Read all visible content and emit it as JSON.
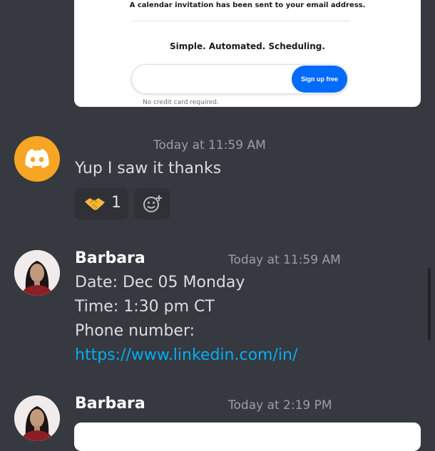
{
  "embed_card": {
    "invite_text": "A calendar invitation has been sent to your email address.",
    "tagline": "Simple. Automated. Scheduling.",
    "signup_button": "Sign up free",
    "note": "No credit card required."
  },
  "messages": [
    {
      "timestamp": "Today at 11:59 AM",
      "text": "Yup I saw it thanks",
      "reactions": [
        {
          "emoji": "handshake-icon",
          "count": "1"
        }
      ]
    },
    {
      "author": "Barbara",
      "timestamp": "Today at 11:59 AM",
      "lines": [
        "Date: Dec 05 Monday",
        "Time: 1:30 pm CT",
        "Phone number:"
      ],
      "link": "https://www.linkedin.com/in/"
    },
    {
      "author": "Barbara",
      "timestamp": "Today at 2:19 PM"
    }
  ],
  "colors": {
    "background": "#36393f",
    "link": "#00aff4",
    "discord_avatar": "#f6a623",
    "signup_button": "#006bff"
  }
}
